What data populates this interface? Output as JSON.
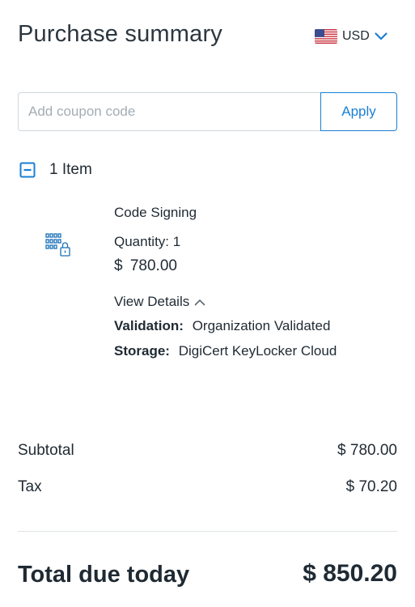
{
  "header": {
    "title": "Purchase summary",
    "currency": "USD",
    "flag_icon": "us-flag-icon"
  },
  "coupon": {
    "placeholder": "Add coupon code",
    "value": "",
    "apply_label": "Apply"
  },
  "items": {
    "count_label": "1 Item",
    "toggle_icon": "collapse-minus-icon",
    "list": [
      {
        "icon": "code-signing-icon",
        "name": "Code Signing",
        "quantity_label": "Quantity:",
        "quantity": "1",
        "currency_symbol": "$",
        "price": "780.00",
        "view_details_label": "View Details",
        "details": [
          {
            "label": "Validation:",
            "value": "Organization Validated"
          },
          {
            "label": "Storage:",
            "value": "DigiCert KeyLocker Cloud"
          }
        ]
      }
    ]
  },
  "summary": {
    "subtotal_label": "Subtotal",
    "subtotal_value": "$ 780.00",
    "tax_label": "Tax",
    "tax_value": "$ 70.20",
    "total_label": "Total due today",
    "total_value": "$ 850.20"
  },
  "colors": {
    "accent": "#1a7fd4",
    "text": "#1f2a33",
    "border": "#cfd6dc"
  }
}
